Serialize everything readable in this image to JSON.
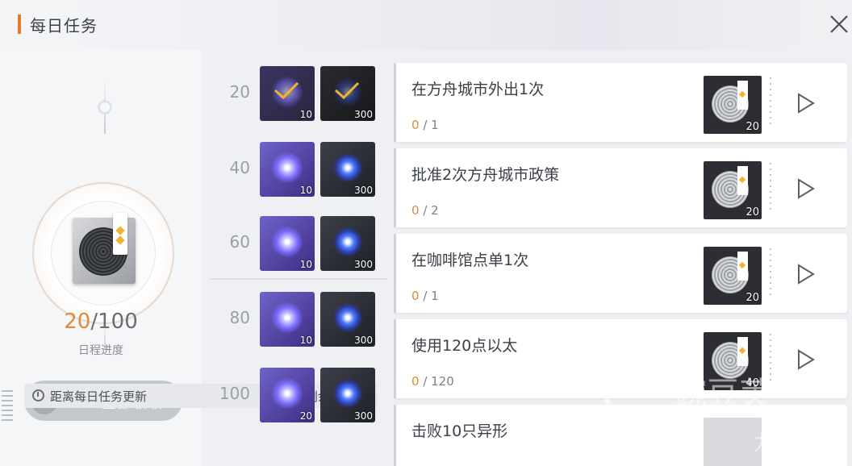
{
  "header": {
    "title": "每日任务"
  },
  "left": {
    "progress_current": "20",
    "progress_total": "/100",
    "progress_label": "日程进度",
    "claim_all_label": "全部领取",
    "footer_text": "距离每日任务更新",
    "footer_remaining": "剩余13小时"
  },
  "milestones": [
    {
      "threshold": "20",
      "star_qty": "10",
      "box_qty": "300",
      "claimed": true
    },
    {
      "threshold": "40",
      "star_qty": "10",
      "box_qty": "300",
      "claimed": false
    },
    {
      "threshold": "60",
      "star_qty": "10",
      "box_qty": "300",
      "claimed": false
    },
    {
      "threshold": "80",
      "star_qty": "10",
      "box_qty": "300",
      "claimed": false
    },
    {
      "threshold": "100",
      "star_qty": "20",
      "box_qty": "300",
      "claimed": false
    }
  ],
  "tasks": [
    {
      "title": "在方舟城市外出1次",
      "current": "0",
      "target": " / 1",
      "reward_qty": "20"
    },
    {
      "title": "批准2次方舟城市政策",
      "current": "0",
      "target": " / 2",
      "reward_qty": "20"
    },
    {
      "title": "在咖啡馆点单1次",
      "current": "0",
      "target": " / 1",
      "reward_qty": "20"
    },
    {
      "title": "使用120点以太",
      "current": "0",
      "target": " / 120",
      "reward_qty": "40"
    },
    {
      "title": "击败10只异形",
      "current": "",
      "target": "",
      "reward_qty": ""
    }
  ],
  "watermark": {
    "text1": "豌豆荚",
    "text2": "九游"
  },
  "colors": {
    "accent": "#e57a2c",
    "progress": "#e08b3b"
  }
}
